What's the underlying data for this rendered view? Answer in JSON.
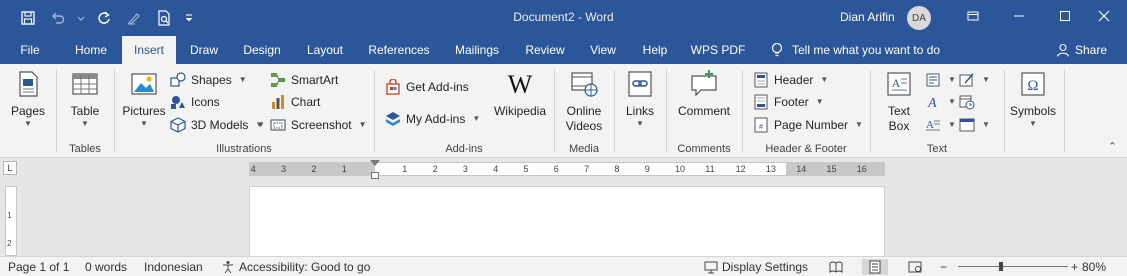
{
  "titlebar": {
    "doc_title": "Document2 - Word",
    "user_name": "Dian Arifin",
    "user_initials": "DA"
  },
  "tabs": [
    {
      "label": "File"
    },
    {
      "label": "Home"
    },
    {
      "label": "Insert"
    },
    {
      "label": "Draw"
    },
    {
      "label": "Design"
    },
    {
      "label": "Layout"
    },
    {
      "label": "References"
    },
    {
      "label": "Mailings"
    },
    {
      "label": "Review"
    },
    {
      "label": "View"
    },
    {
      "label": "Help"
    },
    {
      "label": "WPS PDF"
    }
  ],
  "active_tab": "Insert",
  "tell_me": "Tell me what you want to do",
  "share": "Share",
  "ribbon": {
    "pages": {
      "button": "Pages"
    },
    "tables": {
      "button": "Table",
      "group": "Tables"
    },
    "illustrations": {
      "group": "Illustrations",
      "pictures": "Pictures",
      "shapes": "Shapes",
      "icons": "Icons",
      "models": "3D Models",
      "smartart": "SmartArt",
      "chart": "Chart",
      "screenshot": "Screenshot"
    },
    "addins": {
      "group": "Add-ins",
      "get": "Get Add-ins",
      "my": "My Add-ins",
      "wikipedia": "Wikipedia"
    },
    "media": {
      "group": "Media",
      "online_videos_1": "Online",
      "online_videos_2": "Videos"
    },
    "links": {
      "button": "Links"
    },
    "comments": {
      "group": "Comments",
      "button": "Comment"
    },
    "header_footer": {
      "group": "Header & Footer",
      "header": "Header",
      "footer": "Footer",
      "page_number": "Page Number"
    },
    "text": {
      "group": "Text",
      "textbox_1": "Text",
      "textbox_2": "Box"
    },
    "symbols": {
      "button": "Symbols"
    }
  },
  "ruler_numbers": [
    "4",
    "3",
    "2",
    "1",
    "1",
    "2",
    "3",
    "4",
    "5",
    "6",
    "7",
    "8",
    "9",
    "10",
    "11",
    "12",
    "13",
    "14",
    "15",
    "16"
  ],
  "vruler_numbers": [
    "1",
    "2"
  ],
  "tab_selector": "L",
  "status": {
    "page": "Page 1 of 1",
    "words": "0 words",
    "language": "Indonesian",
    "accessibility": "Accessibility: Good to go",
    "display_settings": "Display Settings",
    "zoom_minus": "−",
    "zoom_plus": "+",
    "zoom": "80%",
    "zoom_level": 0.8
  },
  "colors": {
    "brand": "#2b579a",
    "ribbon_bg": "#f3f3f3",
    "canvas_bg": "#e6e6e6"
  }
}
